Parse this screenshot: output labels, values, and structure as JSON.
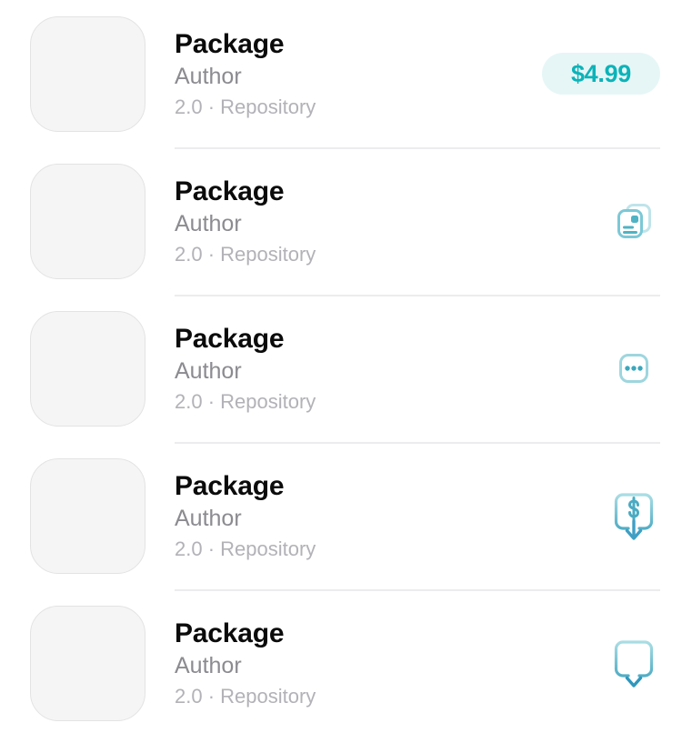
{
  "list": {
    "name": "package-list",
    "rows": [
      {
        "name": "Package",
        "author": "Author",
        "meta": "2.0 · Repository",
        "version": "2.0",
        "separator": "·",
        "repository": "Repository",
        "action_type": "price-badge",
        "action_icon": "price-tag",
        "price": "$4.99"
      },
      {
        "name": "Package",
        "author": "Author",
        "meta": "2.0 · Repository",
        "version": "2.0",
        "separator": "·",
        "repository": "Repository",
        "action_type": "icon",
        "action_icon": "stacked-cards-icon",
        "price": ""
      },
      {
        "name": "Package",
        "author": "Author",
        "meta": "2.0 · Repository",
        "version": "2.0",
        "separator": "·",
        "repository": "Repository",
        "action_type": "icon",
        "action_icon": "more-ellipsis-icon",
        "price": ""
      },
      {
        "name": "Package",
        "author": "Author",
        "meta": "2.0 · Repository",
        "version": "2.0",
        "separator": "·",
        "repository": "Repository",
        "action_type": "icon",
        "action_icon": "purchase-dollar-download-icon",
        "price": ""
      },
      {
        "name": "Package",
        "author": "Author",
        "meta": "2.0 · Repository",
        "version": "2.0",
        "separator": "·",
        "repository": "Repository",
        "action_type": "icon",
        "action_icon": "download-icon",
        "price": ""
      }
    ]
  },
  "colors": {
    "background": "#ffffff",
    "title_text": "#0b0b0b",
    "author_text": "#8b8b90",
    "meta_text": "#b2b2b7",
    "divider": "#ececee",
    "thumbnail_fill": "#f5f5f5",
    "thumbnail_border": "#e3e3e3",
    "badge_background": "#e6f6f6",
    "badge_text": "#0cb3b8",
    "icon_teal_light": "#9ed6de",
    "icon_teal": "#4fb3c4",
    "icon_teal_dark": "#2f9fbe"
  }
}
